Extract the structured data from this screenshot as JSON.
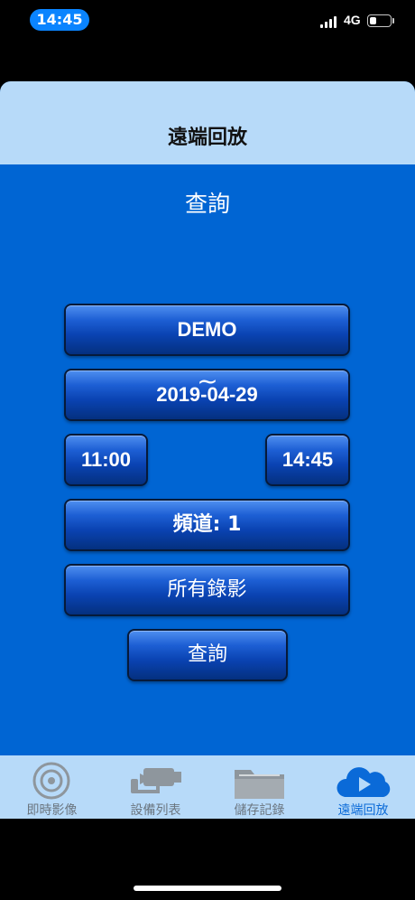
{
  "status_bar": {
    "time": "14:45",
    "network": "4G",
    "battery_level": 0.35
  },
  "nav": {
    "title": "遠端回放"
  },
  "query": {
    "section_title": "查詢",
    "device": "DEMO",
    "date": "2019-04-29",
    "start_time": "11:00",
    "separator": "~",
    "end_time": "14:45",
    "channel": "頻道: 1",
    "record_type": "所有錄影",
    "submit_label": "查詢"
  },
  "tab_bar": {
    "tabs": [
      {
        "label": "即時影像",
        "icon": "live-view-icon",
        "active": false
      },
      {
        "label": "設備列表",
        "icon": "camera-icon",
        "active": false
      },
      {
        "label": "儲存記錄",
        "icon": "folder-icon",
        "active": false
      },
      {
        "label": "遠端回放",
        "icon": "cloud-play-icon",
        "active": true
      }
    ]
  },
  "colors": {
    "background": "#0065d3",
    "bar": "#b7daf9",
    "active_tab": "#0a6ad8",
    "inactive_tab": "#6b7680"
  }
}
